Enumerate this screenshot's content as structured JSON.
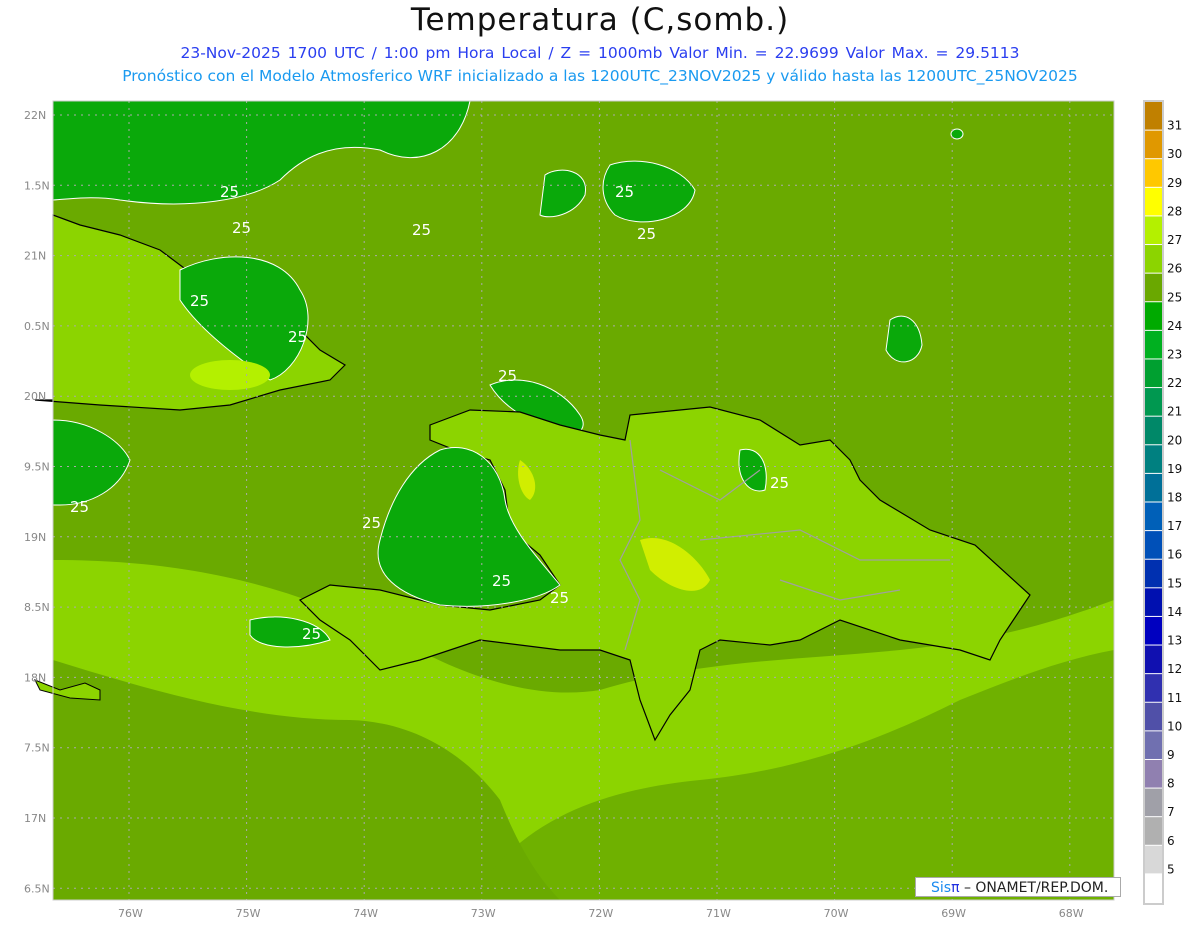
{
  "header": {
    "title": "Temperatura (C,somb.)",
    "subtitle1": "23-Nov-2025  1700 UTC / 1:00 pm Hora Local / Z = 1000mb   Valor Min. = 22.9699  Valor Max. = 29.5113",
    "subtitle2": "Pronóstico con el Modelo Atmosferico WRF inicializado a las 1200UTC_23NOV2025 y válido hasta las  1200UTC_25NOV2025"
  },
  "map": {
    "lat_labels": [
      "22N",
      "1.5N",
      "21N",
      "0.5N",
      "20N",
      "9.5N",
      "19N",
      "8.5N",
      "18N",
      "7.5N",
      "17N",
      "6.5N"
    ],
    "lon_labels": [
      "76W",
      "75W",
      "74W",
      "73W",
      "72W",
      "71W",
      "70W",
      "69W",
      "68W"
    ],
    "contour_label": "25",
    "colors": {
      "band_24_25": "#0aa90a",
      "band_25_26": "#6aaa00",
      "band_26_27": "#8cd400",
      "band_27_28": "#b4f000",
      "band_28_29": "#ffff00",
      "coast": "#000000",
      "borders": "#a0a0a0"
    }
  },
  "colorbar": {
    "labels": [
      "31",
      "30",
      "29",
      "28",
      "27",
      "26",
      "25",
      "24",
      "23",
      "22",
      "21",
      "20",
      "19",
      "18",
      "17",
      "16",
      "15",
      "14",
      "13",
      "12",
      "11",
      "10",
      "9",
      "8",
      "7",
      "6",
      "5"
    ],
    "colors_top_to_bottom": [
      "#c08000",
      "#e09800",
      "#ffc800",
      "#ffff00",
      "#b4f000",
      "#8cd400",
      "#6aa800",
      "#00aa00",
      "#00b020",
      "#00a030",
      "#009850",
      "#008868",
      "#008080",
      "#007098",
      "#0060b8",
      "#0050b8",
      "#0030b0",
      "#0010b0",
      "#0000c0",
      "#1010b0",
      "#3030b0",
      "#5050a8",
      "#7070b0",
      "#9080b0",
      "#a0a0a8",
      "#b0b0b0",
      "#d8d8d8",
      "#ffffff"
    ]
  },
  "footer": {
    "brand_sis": "Sis",
    "brand_pi": "π",
    "credit": " – ONAMET/REP.DOM."
  }
}
